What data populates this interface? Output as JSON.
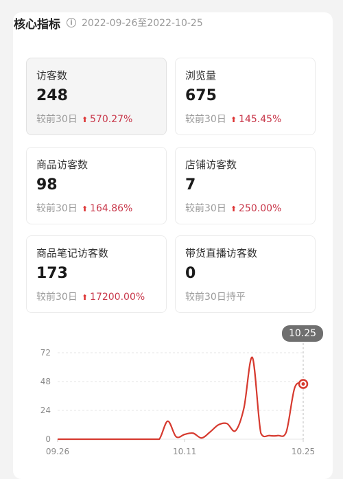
{
  "header": {
    "title": "核心指标",
    "info_icon": "info-icon",
    "date_range": "2022-09-26至2022-10-25"
  },
  "metrics": [
    {
      "label": "访客数",
      "value": "248",
      "compare": "较前30日",
      "change": "570.27%",
      "trend": "up",
      "selected": true
    },
    {
      "label": "浏览量",
      "value": "675",
      "compare": "较前30日",
      "change": "145.45%",
      "trend": "up",
      "selected": false
    },
    {
      "label": "商品访客数",
      "value": "98",
      "compare": "较前30日",
      "change": "164.86%",
      "trend": "up",
      "selected": false
    },
    {
      "label": "店铺访客数",
      "value": "7",
      "compare": "较前30日",
      "change": "250.00%",
      "trend": "up",
      "selected": false
    },
    {
      "label": "商品笔记访客数",
      "value": "173",
      "compare": "较前30日",
      "change": "17200.00%",
      "trend": "up",
      "selected": false
    },
    {
      "label": "带货直播访客数",
      "value": "0",
      "compare": "较前30日持平",
      "change": "",
      "trend": "flat",
      "selected": false
    }
  ],
  "colors": {
    "accent": "#d33",
    "change_text": "#c8374a",
    "line": "#d63a2f"
  },
  "chart_data": {
    "type": "line",
    "title": "",
    "xlabel": "",
    "ylabel": "",
    "ylim": [
      0,
      72
    ],
    "yticks": [
      0,
      24,
      48,
      72
    ],
    "xtick_labels": [
      "09.26",
      "10.11",
      "10.25"
    ],
    "grid": true,
    "x": [
      "09.26",
      "09.27",
      "09.28",
      "09.29",
      "09.30",
      "10.01",
      "10.02",
      "10.03",
      "10.04",
      "10.05",
      "10.06",
      "10.07",
      "10.08",
      "10.09",
      "10.10",
      "10.11",
      "10.12",
      "10.13",
      "10.14",
      "10.15",
      "10.16",
      "10.17",
      "10.18",
      "10.19",
      "10.20",
      "10.21",
      "10.22",
      "10.23",
      "10.24",
      "10.25"
    ],
    "series": [
      {
        "values": [
          0,
          0,
          0,
          0,
          0,
          0,
          0,
          0,
          0,
          0,
          0,
          0,
          0,
          15,
          2,
          4,
          5,
          1,
          6,
          12,
          13,
          7,
          26,
          68,
          5,
          3,
          3,
          6,
          43,
          46
        ]
      }
    ],
    "tooltip": "10.25",
    "highlight_index": 29
  }
}
